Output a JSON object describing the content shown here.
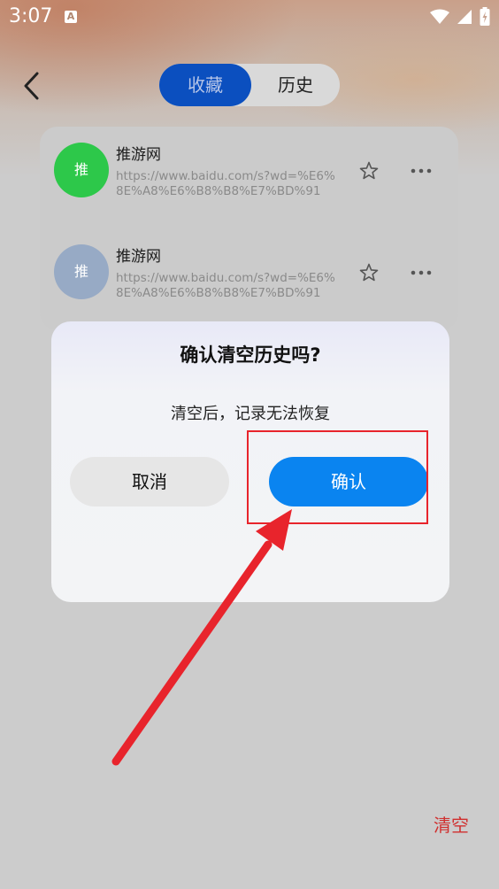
{
  "status_bar": {
    "time": "3:07",
    "notification_glyph": "A"
  },
  "header": {
    "tabs": [
      {
        "label": "收藏",
        "active": true
      },
      {
        "label": "历史",
        "active": false
      }
    ]
  },
  "history": {
    "items": [
      {
        "avatar_text": "推",
        "avatar_color": "#2dc84a",
        "title": "推游网",
        "url": "https://www.baidu.com/s?wd=%E6%8E%A8%E6%B8%B8%E7%BD%91"
      },
      {
        "avatar_text": "推",
        "avatar_color": "#97aac5",
        "title": "推游网",
        "url": "https://www.baidu.com/s?wd=%E6%8E%A8%E6%B8%B8%E7%BD%91"
      }
    ]
  },
  "dialog": {
    "title": "确认清空历史吗?",
    "message": "清空后，记录无法恢复",
    "cancel_label": "取消",
    "confirm_label": "确认"
  },
  "footer": {
    "clear_label": "清空"
  },
  "colors": {
    "accent_blue": "#0a84f0",
    "tab_active": "#0b4fbf",
    "annotation_red": "#e8242c",
    "clear_red": "#d0302f"
  }
}
